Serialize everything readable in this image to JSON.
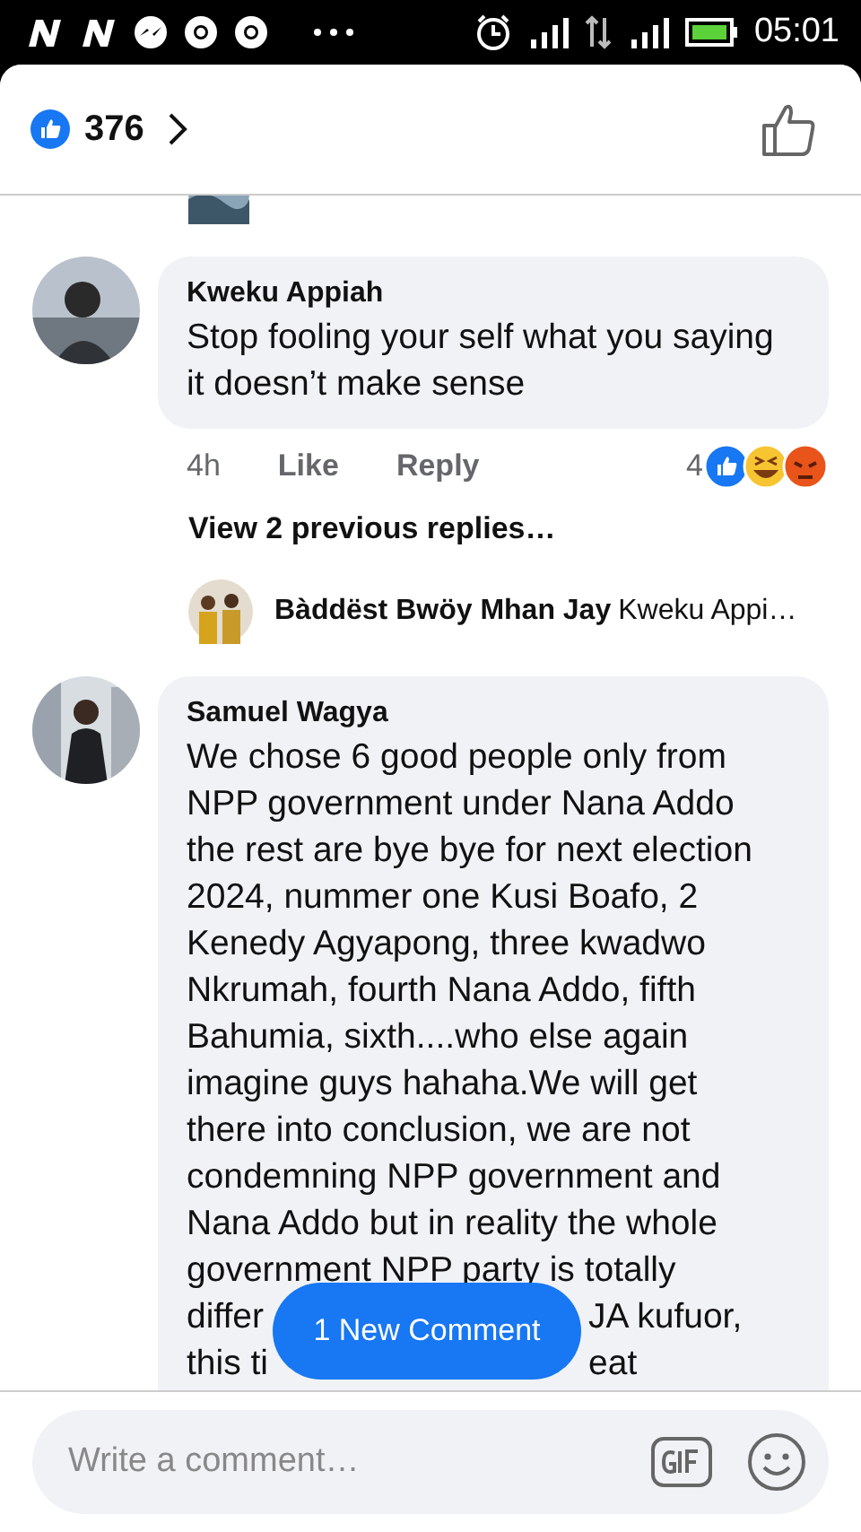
{
  "status_bar": {
    "time": "05:01"
  },
  "header": {
    "like_count": "376"
  },
  "thread": [
    {
      "kind": "comment",
      "author": "Kweku Appiah",
      "text": "Stop fooling your self what you saying it doesn’t make sense",
      "time": "4h",
      "actions": [
        "Like",
        "Reply"
      ],
      "reaction_count": "4"
    },
    {
      "kind": "more",
      "text": "View 2 previous replies…"
    },
    {
      "kind": "reply",
      "author": "Bàddëst Bwöy Mhan Jay",
      "text": "Kweku Appi…"
    },
    {
      "kind": "long",
      "author": "Samuel Wagya",
      "text": "We chose 6 good people only from NPP government under Nana Addo the rest are bye bye for next election 2024, nummer one Kusi Boafo, 2 Kenedy Agyapong, three kwadwo Nkrumah, fourth Nana Addo, fifth Bahumia, sixth....who else again imagine guys hahaha.We will get there into conclusion, we are not condemning NPP government and Nana Addo but in reality the whole government NPP party is totally",
      "covered_lines": [
        [
          "differ",
          "JA kufuor,"
        ],
        [
          "this ti",
          "eat"
        ]
      ]
    }
  ],
  "new_comment_button": "1 New Comment",
  "composer": {
    "placeholder": "Write a comment…"
  }
}
